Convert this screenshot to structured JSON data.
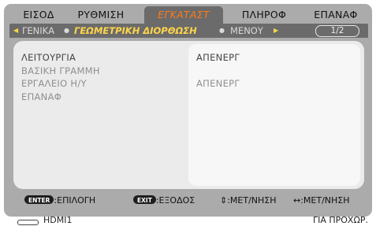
{
  "tabs": [
    {
      "label": "ΕΙΣΟΔ",
      "active": false
    },
    {
      "label": "ΡΥΘΜΙΣΗ",
      "active": false
    },
    {
      "label": "ΕΓΚΑΤΑΣΤ",
      "active": true
    },
    {
      "label": "ΠΛΗΡΟΦ",
      "active": false
    },
    {
      "label": "ΕΠΑΝΑΦ",
      "active": false
    }
  ],
  "subtabs": {
    "left_arrow": "◀",
    "items": [
      {
        "label": "ΓΕΝΙΚΑ",
        "active": false
      },
      {
        "label": "ΓΕΩΜΕΤΡΙΚΗ ΔΙΟΡΘΩΣΗ",
        "active": true
      },
      {
        "label": "ΜΕΝΟΥ",
        "active": false
      }
    ],
    "right_arrow": "▶",
    "page_indicator": "1/2"
  },
  "menu": {
    "items": [
      {
        "label": "ΛΕΙΤΟΥΡΓΙΑ",
        "value": "ΑΠΕΝΕΡΓ",
        "enabled": true
      },
      {
        "label": "ΒΑΣΙΚΗ ΓΡΑΜΜΗ",
        "value": "",
        "enabled": false
      },
      {
        "label": "ΕΡΓΑΛΕΙΟ Η/Υ",
        "value": "ΑΠΕΝΕΡΓ",
        "enabled": false
      },
      {
        "label": "ΕΠΑΝΑΦ",
        "value": "",
        "enabled": false
      }
    ]
  },
  "help": {
    "enter_key": "ENTER",
    "enter_text": ":ΕΠΙΛΟΓΗ",
    "exit_key": "EXIT",
    "exit_text": ":ΕΞΟΔΟΣ",
    "updown_text": "⇕:ΜΕΤ/ΝΗΣΗ",
    "leftright_text": "↔:ΜΕΤ/ΝΗΣΗ"
  },
  "status": {
    "source_icon": "hdmi-icon",
    "source": "HDMI1",
    "state": "ΓΙΑ ΠΡΟΧΩΡ."
  },
  "colors": {
    "active_tab_text": "#ff7a1a",
    "active_subtab_text": "#ffd54a",
    "frame": "#ababab",
    "bar": "#6b6b6b",
    "panel": "#ebebeb"
  }
}
